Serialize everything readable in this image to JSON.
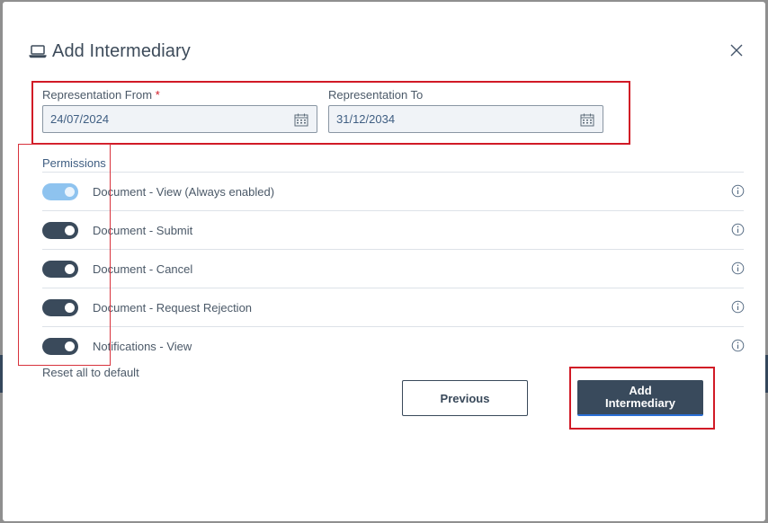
{
  "dialog": {
    "title": "Add Intermediary",
    "title_icon": "laptop-icon",
    "close_icon": "close-icon"
  },
  "representation": {
    "from_label": "Representation From",
    "required_mark": "*",
    "from_value": "24/07/2024",
    "to_label": "Representation To",
    "to_value": "31/12/2034",
    "calendar_icon": "calendar-icon"
  },
  "permissions": {
    "title": "Permissions",
    "items": [
      {
        "label": "Document - View (Always enabled)",
        "enabled": true,
        "disabled": true
      },
      {
        "label": "Document - Submit",
        "enabled": true,
        "disabled": false
      },
      {
        "label": "Document - Cancel",
        "enabled": true,
        "disabled": false
      },
      {
        "label": "Document - Request Rejection",
        "enabled": true,
        "disabled": false
      },
      {
        "label": "Notifications - View",
        "enabled": true,
        "disabled": false
      }
    ],
    "info_icon": "info-icon"
  },
  "reset_label": "Reset all to default",
  "buttons": {
    "previous": "Previous",
    "add": "Add Intermediary"
  },
  "colors": {
    "primary": "#394a5c",
    "highlight_red": "#d11a26",
    "toggle_disabled": "#8ec3ef"
  }
}
